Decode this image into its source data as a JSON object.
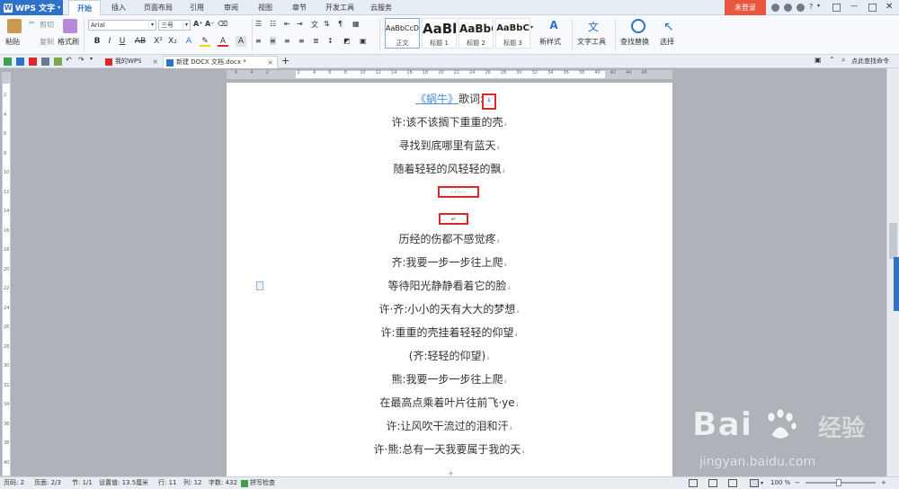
{
  "app": {
    "name": "WPS 文字",
    "logo_letter": "W"
  },
  "menu_tabs": [
    {
      "label": "开始",
      "active": true
    },
    {
      "label": "插入"
    },
    {
      "label": "页面布局"
    },
    {
      "label": "引用"
    },
    {
      "label": "审阅"
    },
    {
      "label": "视图"
    },
    {
      "label": "章节"
    },
    {
      "label": "开发工具"
    },
    {
      "label": "云服务"
    }
  ],
  "login_label": "未登录",
  "ribbon": {
    "paste": "粘贴",
    "cut": "剪切",
    "copy": "复制",
    "format_painter": "格式刷",
    "font_name": "Arial",
    "font_size": "三号",
    "styles": [
      {
        "sample": "AaBbCcDd",
        "caption": "正文"
      },
      {
        "sample": "AaBb",
        "caption": "标题 1"
      },
      {
        "sample": "AaBbC",
        "caption": "标题 2"
      },
      {
        "sample": "AaBbC",
        "caption": "标题 3"
      }
    ],
    "new_style": "新样式",
    "text_tools": "文字工具",
    "find_replace": "查找替换",
    "select": "选择"
  },
  "quick_access_find": "点此查找命令",
  "doc_tabs": [
    {
      "label": "我的WPS",
      "active": false
    },
    {
      "label": "新建 DOCX 文档.docx *",
      "active": true
    }
  ],
  "ruler": {
    "h_numbers": [
      "6",
      "4",
      "2",
      "",
      "2",
      "4",
      "6",
      "8",
      "10",
      "12",
      "14",
      "16",
      "18",
      "20",
      "22",
      "24",
      "26",
      "28",
      "30",
      "32",
      "34",
      "36",
      "38",
      "40",
      "42",
      "44",
      "46"
    ],
    "v_numbers": [
      "2",
      "4",
      "6",
      "8",
      "10",
      "12",
      "14",
      "16",
      "18",
      "20",
      "22",
      "24",
      "26",
      "28",
      "30",
      "32",
      "34",
      "36",
      "38",
      "40"
    ]
  },
  "document": {
    "title_link": "《蜗牛》",
    "title_rest": "歌词:",
    "para_mark": "↓",
    "lines_before": [
      "许:该不该搁下重重的壳",
      "寻找到底哪里有蓝天",
      "随着轻轻的风轻轻的飘"
    ],
    "dots": "·····",
    "return_mark": "↵",
    "lines_after": [
      "历经的伤都不感觉疼",
      "齐:我要一步一步往上爬",
      "等待阳光静静看着它的脸",
      "许·齐:小小的天有大大的梦想",
      "许:重重的壳挂着轻轻的仰望",
      "(齐:轻轻的仰望)",
      "熊:我要一步一步往上爬",
      "在最高点乘着叶片往前飞·ye",
      "许:让风吹干流过的泪和汗",
      "许·熊:总有一天我要属于我的天"
    ]
  },
  "status": {
    "page_code": "页码: 2",
    "pages": "页面: 2/3",
    "section": "节: 1/1",
    "setting": "设置值: 13.5厘米",
    "row": "行: 11",
    "col": "列: 12",
    "words": "字数: 432",
    "spell": "拼写检查",
    "zoom": "100 %"
  },
  "watermark": {
    "brand_left": "Bai",
    "brand_right": "经验",
    "url": "jingyan.baidu.com"
  },
  "colors": {
    "accent": "#2e72c8",
    "login": "#e8563f",
    "highlight": "#e0262b",
    "link": "#4a90d9"
  }
}
